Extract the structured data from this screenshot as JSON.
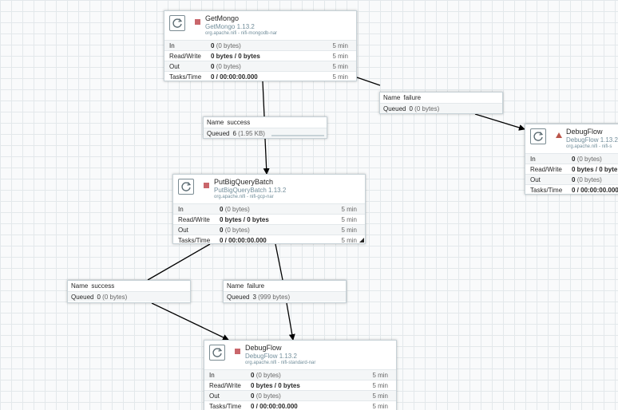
{
  "processors": {
    "getmongo": {
      "name": "GetMongo",
      "type": "GetMongo 1.13.2",
      "bundle": "org.apache.nifi - nifi-mongodb-nar",
      "in_count": "0",
      "in_size": "(0 bytes)",
      "rw": "0 bytes / 0 bytes",
      "out_count": "0",
      "out_size": "(0 bytes)",
      "tasks": "0 / 00:00:00.000",
      "window": "5 min"
    },
    "putbigquery": {
      "name": "PutBigQueryBatch",
      "type": "PutBigQueryBatch 1.13.2",
      "bundle": "org.apache.nifi - nifi-gcp-nar",
      "in_count": "0",
      "in_size": "(0 bytes)",
      "rw": "0 bytes / 0 bytes",
      "out_count": "0",
      "out_size": "(0 bytes)",
      "tasks": "0 / 00:00:00.000",
      "window": "5 min"
    },
    "debug_right": {
      "name": "DebugFlow",
      "type": "DebugFlow 1.13.2",
      "bundle": "org.apache.nifi - nifi-s",
      "in_count": "0",
      "in_size": "(0 bytes)",
      "rw": "0 bytes / 0 byte",
      "out_count": "0",
      "out_size": "(0 bytes)",
      "tasks": "0 / 00:00:00.000"
    },
    "debug_bottom": {
      "name": "DebugFlow",
      "type": "DebugFlow 1.13.2",
      "bundle": "org.apache.nifi - nifi-standard-nar",
      "in_count": "0",
      "in_size": "(0 bytes)",
      "rw": "0 bytes / 0 bytes",
      "out_count": "0",
      "out_size": "(0 bytes)",
      "tasks": "0 / 00:00:00.000",
      "window": "5 min"
    }
  },
  "labels": {
    "in": "In",
    "rw": "Read/Write",
    "out": "Out",
    "tasks": "Tasks/Time",
    "name": "Name",
    "queued": "Queued"
  },
  "connections": {
    "mongo_success": {
      "name": "success",
      "count": "6",
      "size": "(1.95 KB)",
      "queue_fill": 0.9
    },
    "mongo_failure": {
      "name": "failure",
      "count": "0",
      "size": "(0 bytes)",
      "queue_fill": 0
    },
    "bq_success": {
      "name": "success",
      "count": "0",
      "size": "(0 bytes)",
      "queue_fill": 0
    },
    "bq_failure": {
      "name": "failure",
      "count": "3",
      "size": "(999 bytes)",
      "queue_fill": 0
    }
  },
  "colors": {
    "stopped": "#c9666b",
    "invalid": "#ba554a",
    "edge": "#000000"
  }
}
